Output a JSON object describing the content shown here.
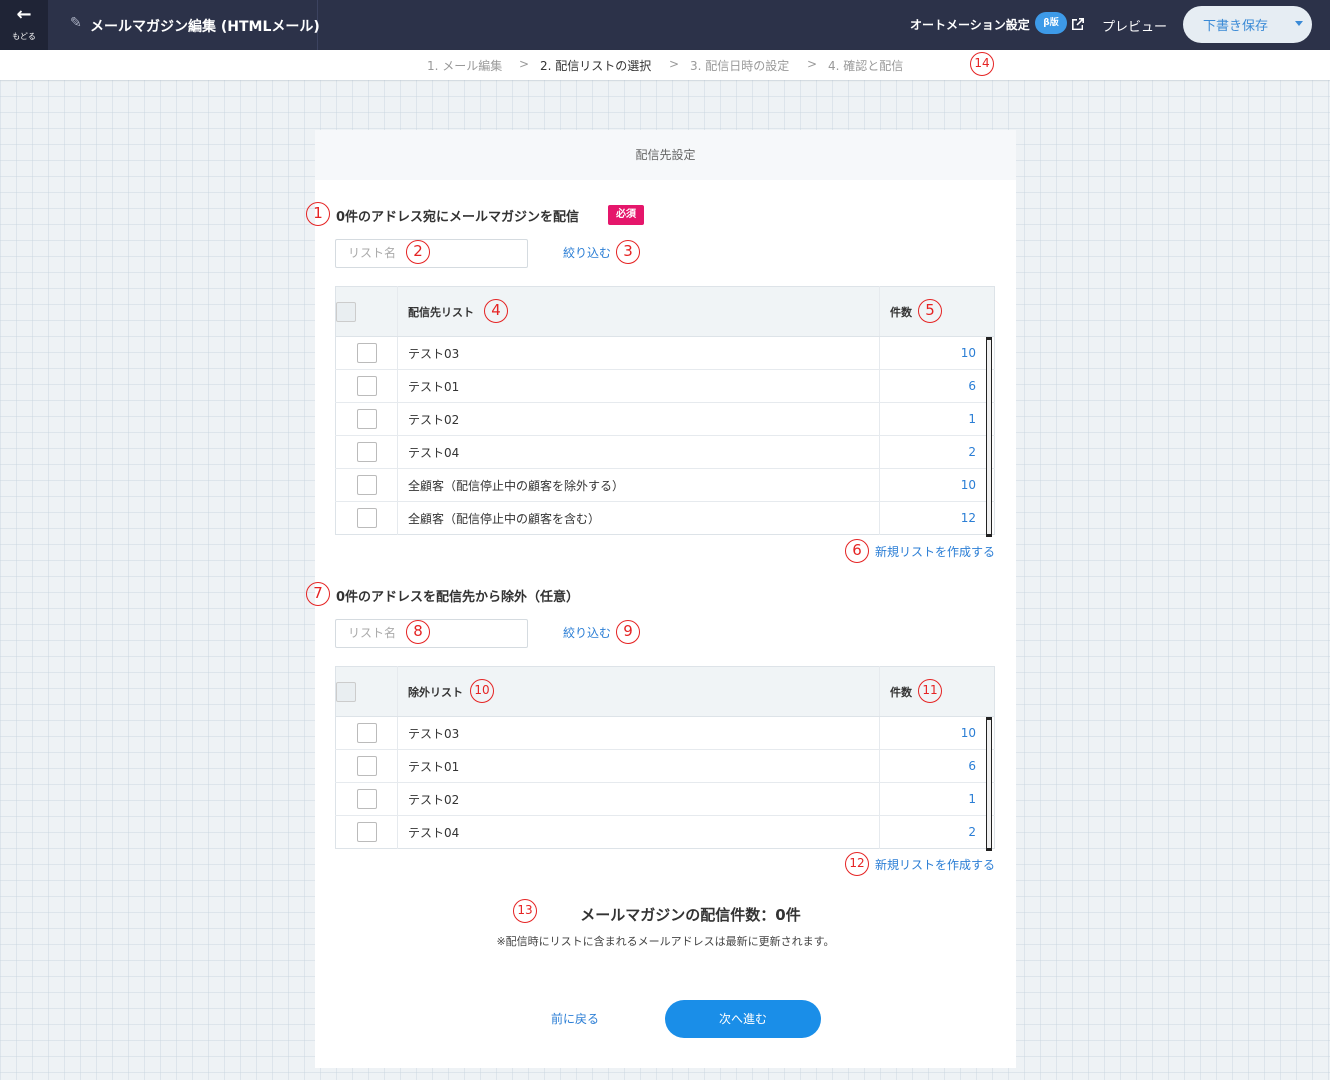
{
  "topbar": {
    "back_label": "もどる",
    "title": "メールマガジン編集 (HTMLメール)",
    "automation_label": "オートメーション設定",
    "beta_badge": "β版",
    "preview_label": "プレビュー",
    "save_label": "下書き保存",
    "bg_color": "#2c3249"
  },
  "steps": [
    {
      "label": "1. メール編集"
    },
    {
      "label": "2. 配信リストの選択",
      "active": true
    },
    {
      "label": "3. 配信日時の設定"
    },
    {
      "label": "4. 確認と配信"
    }
  ],
  "step_separator": ">",
  "card": {
    "header": "配信先設定",
    "section1": {
      "title": "0件のアドレス宛にメールマガジンを配信",
      "required_badge": "必須",
      "search_placeholder": "リスト名",
      "filter_label": "絞り込む",
      "col_list": "配信先リスト",
      "col_count": "件数",
      "rows": [
        {
          "name": "テスト03",
          "count": "10"
        },
        {
          "name": "テスト01",
          "count": "6"
        },
        {
          "name": "テスト02",
          "count": "1"
        },
        {
          "name": "テスト04",
          "count": "2"
        },
        {
          "name": "全顧客（配信停止中の顧客を除外する）",
          "count": "10"
        },
        {
          "name": "全顧客（配信停止中の顧客を含む）",
          "count": "12"
        }
      ],
      "new_list_label": "新規リストを作成する"
    },
    "section2": {
      "title": "0件のアドレスを配信先から除外（任意）",
      "search_placeholder": "リスト名",
      "filter_label": "絞り込む",
      "col_list": "除外リスト",
      "col_count": "件数",
      "rows": [
        {
          "name": "テスト03",
          "count": "10"
        },
        {
          "name": "テスト01",
          "count": "6"
        },
        {
          "name": "テスト02",
          "count": "1"
        },
        {
          "name": "テスト04",
          "count": "2"
        }
      ],
      "new_list_label": "新規リストを作成する"
    },
    "total_label": "メールマガジンの配信件数：0件",
    "note": "※配信時にリストに含まれるメールアドレスは最新に更新されます。",
    "prev_label": "前に戻る",
    "next_label": "次へ進む"
  },
  "markers": [
    "1",
    "2",
    "3",
    "4",
    "5",
    "6",
    "7",
    "8",
    "9",
    "10",
    "11",
    "12",
    "13",
    "14"
  ],
  "colors": {
    "accent": "#1a8ee8",
    "link": "#2b7ed5",
    "required": "#e5166b",
    "marker": "#e52323"
  }
}
